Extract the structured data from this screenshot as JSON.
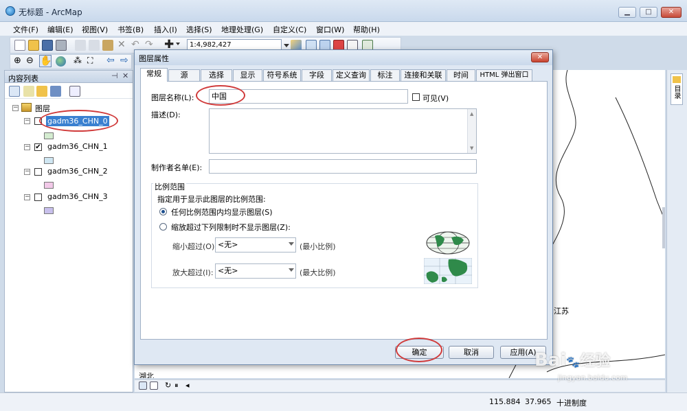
{
  "window": {
    "title": "无标题 - ArcMap",
    "min": "▁",
    "max": "□",
    "close": "✕"
  },
  "menu": [
    "文件(F)",
    "编辑(E)",
    "视图(V)",
    "书签(B)",
    "插入(I)",
    "选择(S)",
    "地理处理(G)",
    "自定义(C)",
    "窗口(W)",
    "帮助(H)"
  ],
  "toolbar": {
    "scale": "1:4,982,427"
  },
  "toc": {
    "title": "内容列表",
    "root": "图层",
    "layers": [
      {
        "name": "gadm36_CHN_0",
        "checked": false,
        "selected": true,
        "color": "#d4ecd0"
      },
      {
        "name": "gadm36_CHN_1",
        "checked": true,
        "selected": false,
        "color": "#cfe6f2"
      },
      {
        "name": "gadm36_CHN_2",
        "checked": false,
        "selected": false,
        "color": "#f2c9e8"
      },
      {
        "name": "gadm36_CHN_3",
        "checked": false,
        "selected": false,
        "color": "#c8c0ec"
      }
    ]
  },
  "map": {
    "label_jiangsu": "江苏",
    "label_hubei": "湖北"
  },
  "right_panel": {
    "label": "目录"
  },
  "status": {
    "x": "115.884",
    "y": "37.965",
    "units": "十进制度"
  },
  "watermark": {
    "brand": "Bai",
    "brand_cn": "经验",
    "url": "jingyan.baidu.com"
  },
  "dialog": {
    "title": "图层属性",
    "close": "✕",
    "tabs": [
      "常规",
      "源",
      "选择",
      "显示",
      "符号系统",
      "字段",
      "定义查询",
      "标注",
      "连接和关联",
      "时间",
      "HTML 弹出窗口"
    ],
    "layer_name_label": "图层名称(L):",
    "layer_name_value": "中国",
    "visible_label": "可见(V)",
    "description_label": "描述(D):",
    "credits_label": "制作者名单(E):",
    "scale_group_title": "比例范围",
    "scale_group_desc": "指定用于显示此图层的比例范围:",
    "radio_any": "任何比例范围内均显示图层(S)",
    "radio_limit": "缩放超过下列限制时不显示图层(Z):",
    "min_label": "缩小超过(O):",
    "min_value": "<无>",
    "min_hint": "(最小比例)",
    "max_label": "放大超过(I):",
    "max_value": "<无>",
    "max_hint": "(最大比例)",
    "ok": "确定",
    "cancel": "取消",
    "apply": "应用(A)"
  }
}
